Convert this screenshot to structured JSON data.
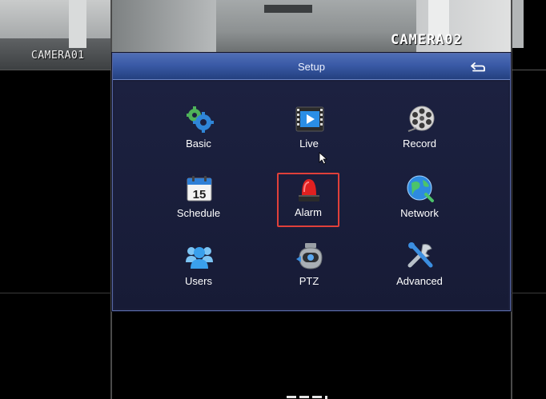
{
  "cameras": {
    "cam1_label": "CAMERA01",
    "cam2_label": "CAMERA02"
  },
  "dialog": {
    "title": "Setup",
    "back_icon": "return-arrow-icon"
  },
  "menu": {
    "items": [
      {
        "label": "Basic",
        "icon": "gears-icon"
      },
      {
        "label": "Live",
        "icon": "video-play-icon"
      },
      {
        "label": "Record",
        "icon": "film-reel-icon"
      },
      {
        "label": "Schedule",
        "icon": "calendar-icon"
      },
      {
        "label": "Alarm",
        "icon": "siren-icon",
        "selected": true
      },
      {
        "label": "Network",
        "icon": "globe-icon"
      },
      {
        "label": "Users",
        "icon": "users-icon"
      },
      {
        "label": "PTZ",
        "icon": "ptz-camera-icon"
      },
      {
        "label": "Advanced",
        "icon": "tools-icon"
      }
    ],
    "calendar_day": "15"
  },
  "colors": {
    "header": "#3a5aa6",
    "body": "#1a1e3a",
    "selection": "#e0403a"
  }
}
